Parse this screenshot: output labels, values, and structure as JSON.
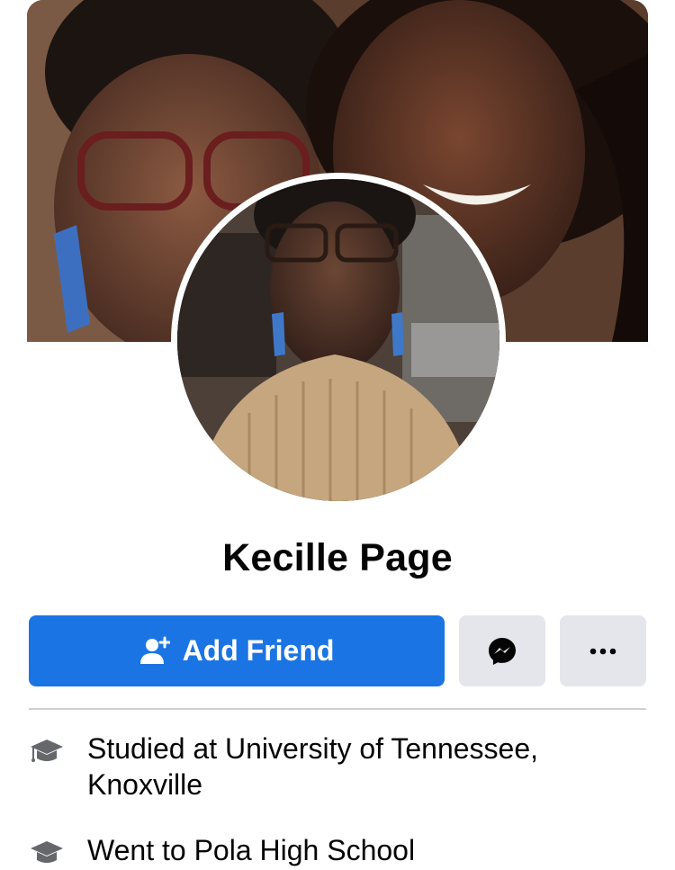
{
  "profile": {
    "name": "Kecille Page"
  },
  "actions": {
    "add_friend_label": "Add Friend",
    "messenger_icon": "messenger-icon",
    "more_icon": "more-dots-icon"
  },
  "intro": {
    "items": [
      {
        "icon": "graduation-cap-icon",
        "prefix": "Studied at ",
        "value": "University of Tennessee, Knoxville"
      },
      {
        "icon": "graduation-cap-icon",
        "prefix": "Went to ",
        "value": "Pola High School"
      }
    ]
  },
  "colors": {
    "primary_button": "#1b74e4",
    "secondary_button": "#e4e6eb",
    "divider": "#ced0d4",
    "text": "#050505",
    "icon_gray": "#65676b"
  }
}
